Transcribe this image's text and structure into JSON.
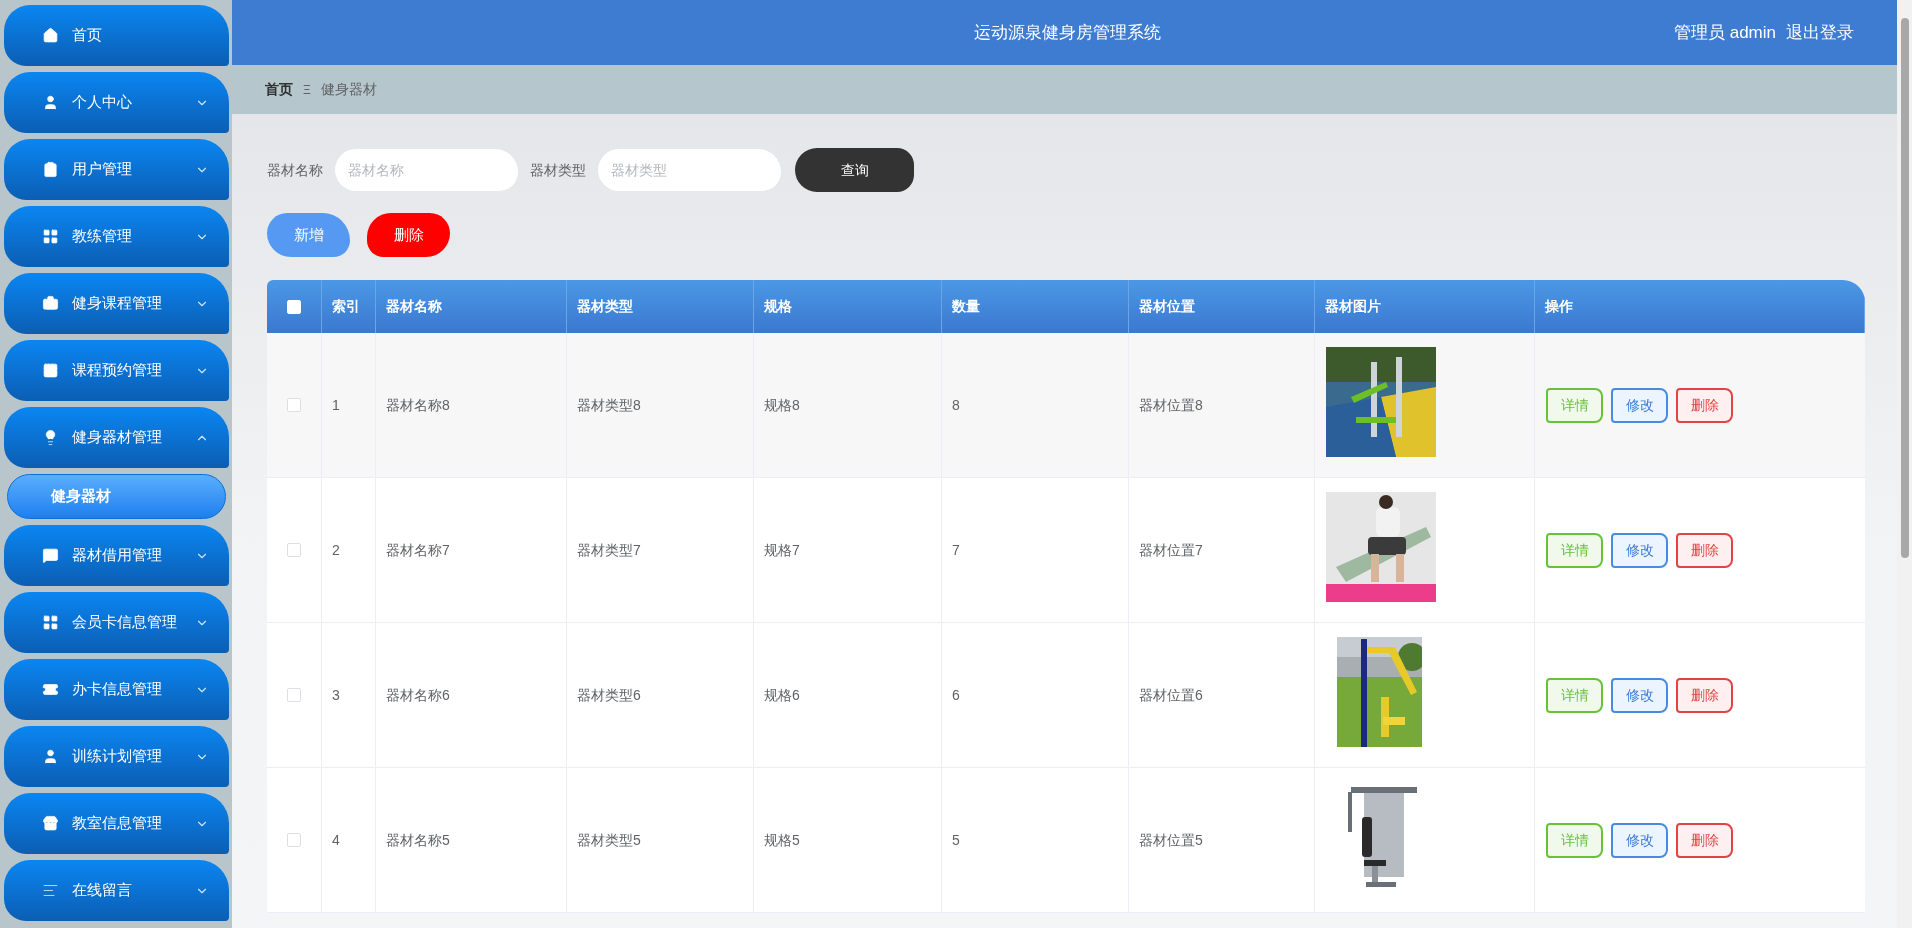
{
  "sidebar": {
    "items": [
      {
        "label": "首页",
        "expandable": false
      },
      {
        "label": "个人中心",
        "expandable": true,
        "expanded": false
      },
      {
        "label": "用户管理",
        "expandable": true,
        "expanded": false
      },
      {
        "label": "教练管理",
        "expandable": true,
        "expanded": false
      },
      {
        "label": "健身课程管理",
        "expandable": true,
        "expanded": false
      },
      {
        "label": "课程预约管理",
        "expandable": true,
        "expanded": false
      },
      {
        "label": "健身器材管理",
        "expandable": true,
        "expanded": true,
        "children": [
          {
            "label": "健身器材",
            "selected": true
          }
        ]
      },
      {
        "label": "器材借用管理",
        "expandable": true,
        "expanded": false
      },
      {
        "label": "会员卡信息管理",
        "expandable": true,
        "expanded": false
      },
      {
        "label": "办卡信息管理",
        "expandable": true,
        "expanded": false
      },
      {
        "label": "训练计划管理",
        "expandable": true,
        "expanded": false
      },
      {
        "label": "教室信息管理",
        "expandable": true,
        "expanded": false
      },
      {
        "label": "在线留言",
        "expandable": true,
        "expanded": false
      }
    ]
  },
  "header": {
    "title": "运动源泉健身房管理系统",
    "user": "管理员 admin",
    "logout": "退出登录"
  },
  "breadcrumb": {
    "home": "首页",
    "separator": "Ξ",
    "current": "健身器材"
  },
  "search": {
    "fields": [
      {
        "label": "器材名称",
        "placeholder": "器材名称"
      },
      {
        "label": "器材类型",
        "placeholder": "器材类型"
      }
    ],
    "button": "查询"
  },
  "actions": {
    "add": "新增",
    "delete": "删除"
  },
  "table": {
    "select_all_checked": false,
    "columns": [
      "索引",
      "器材名称",
      "器材类型",
      "规格",
      "数量",
      "器材位置",
      "器材图片",
      "操作"
    ],
    "rows": [
      {
        "checked": false,
        "cells": [
          "1",
          "器材名称8",
          "器材类型8",
          "规格8",
          "8",
          "器材位置8"
        ],
        "buttons": [
          "详情",
          "修改",
          "删除"
        ]
      },
      {
        "checked": false,
        "cells": [
          "2",
          "器材名称7",
          "器材类型7",
          "规格7",
          "7",
          "器材位置7"
        ],
        "buttons": [
          "详情",
          "修改",
          "删除"
        ]
      },
      {
        "checked": false,
        "cells": [
          "3",
          "器材名称6",
          "器材类型6",
          "规格6",
          "6",
          "器材位置6"
        ],
        "buttons": [
          "详情",
          "修改",
          "删除"
        ]
      },
      {
        "checked": false,
        "cells": [
          "4",
          "器材名称5",
          "器材类型5",
          "规格5",
          "5",
          "器材位置5"
        ],
        "buttons": [
          "详情",
          "修改",
          "删除"
        ]
      }
    ]
  }
}
